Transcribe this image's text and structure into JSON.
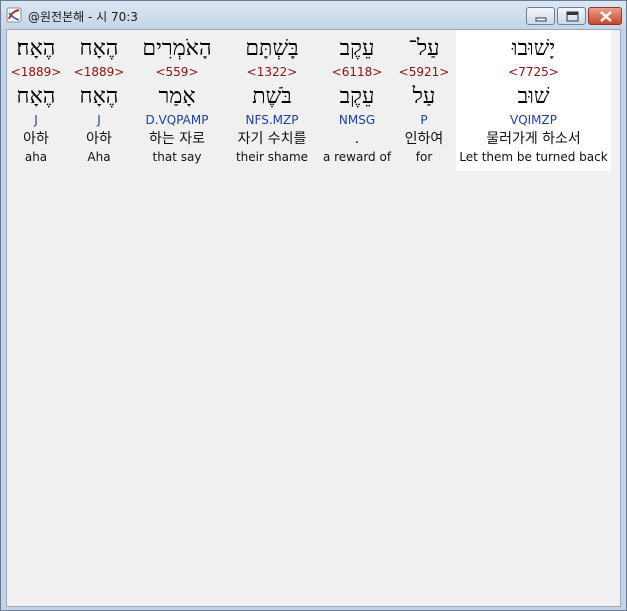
{
  "window": {
    "title": "@원전본해 - 시 70:3",
    "icon": "app-swirl-icon",
    "controls": [
      "minimize-icon",
      "maximize-icon",
      "close-icon"
    ]
  },
  "colors": {
    "strong": "#8b1010",
    "morph": "#1d3fa0",
    "highlight": "#ffffff",
    "background": "#f0f0f0"
  },
  "words": [
    {
      "hebrew": "הֶאָח׃",
      "strong": "<1889>",
      "lemma": "הֶאָח",
      "morph": "J",
      "korean": "아하",
      "english": "aha"
    },
    {
      "hebrew": "הֶאָח",
      "strong": "<1889>",
      "lemma": "הֶאָח",
      "morph": "J",
      "korean": "아하",
      "english": "Aha"
    },
    {
      "hebrew": "הָאֹמְרִים",
      "strong": "<559>",
      "lemma": "אָמַר",
      "morph": "D.VQPAMP",
      "korean": "하는 자로",
      "english": "that say"
    },
    {
      "hebrew": "בָּשְׁתָּם",
      "strong": "<1322>",
      "lemma": "בֹּשֶׁת",
      "morph": "NFS.MZP",
      "korean": "자기 수치를",
      "english": "their shame"
    },
    {
      "hebrew": "עֵקֶב",
      "strong": "<6118>",
      "lemma": "עֵקֶב",
      "morph": "NMSG",
      "korean": ".",
      "english": "a reward of"
    },
    {
      "hebrew": "עַל־",
      "strong": "<5921>",
      "lemma": "עַל",
      "morph": "P",
      "korean": "인하여",
      "english": "for"
    },
    {
      "hebrew": "יָשׁוּבוּ",
      "strong": "<7725>",
      "lemma": "שׁוּב",
      "morph": "VQIMZP",
      "korean": "물러가게 하소서",
      "english": "Let them be turned back"
    }
  ]
}
